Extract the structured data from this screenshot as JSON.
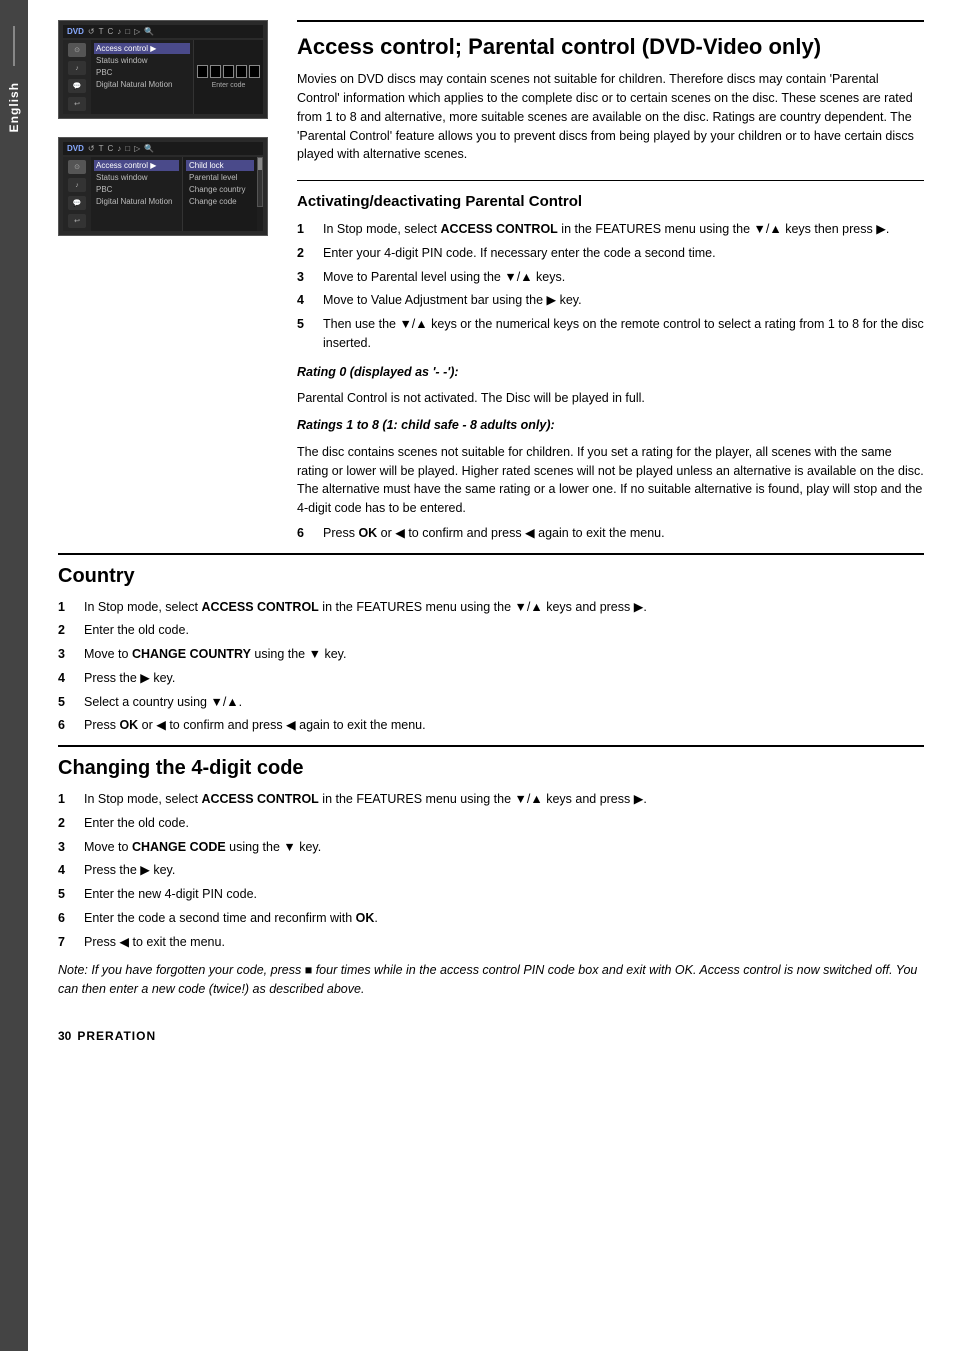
{
  "side_tab": {
    "label": "English"
  },
  "page": {
    "title": "Access control; Parental control (DVD-Video only)",
    "intro": "Movies on DVD discs may contain scenes not suitable for children. Therefore discs may contain 'Parental Control' information which applies to the complete disc or to certain scenes on the disc. These scenes are rated from 1 to 8 and alternative, more suitable scenes are available on the disc. Ratings are country dependent. The 'Parental Control' feature allows you to prevent discs from being played by your children or to have certain discs played with alternative scenes."
  },
  "section1": {
    "heading": "Activating/deactivating Parental Control",
    "steps": [
      {
        "num": "1",
        "text": "In Stop mode, select ACCESS CONTROL in the FEATURES menu using the ▼/▲ keys then press ▶."
      },
      {
        "num": "2",
        "text": "Enter your 4-digit PIN code. If necessary enter the code a second time."
      },
      {
        "num": "3",
        "text": "Move to Parental level using the ▼/▲ keys."
      },
      {
        "num": "4",
        "text": "Move to Value Adjustment bar using the ▶ key."
      },
      {
        "num": "5",
        "text": "Then use the ▼/▲ keys or the numerical keys on the remote control to select a rating from 1 to 8 for the disc inserted."
      }
    ],
    "rating0_label": "Rating 0 (displayed as '- -'):",
    "rating0_text": "Parental Control is not activated. The Disc will be played in full.",
    "ratings18_label": "Ratings 1 to 8 (1: child safe - 8 adults only):",
    "ratings18_text": "The disc contains scenes not suitable for children. If you set a rating for the player, all scenes with the same rating or lower will be played. Higher rated scenes will not be played unless an alternative is available on the disc. The alternative must have the same rating or a lower one. If no suitable alternative is found, play will stop and the 4-digit code has to be entered.",
    "step6": {
      "num": "6",
      "text": "Press OK or ◀ to confirm and press ◀ again to exit the menu."
    }
  },
  "section_country": {
    "heading": "Country",
    "steps": [
      {
        "num": "1",
        "text": "In Stop mode, select ACCESS CONTROL in the FEATURES menu using the ▼/▲ keys and press ▶."
      },
      {
        "num": "2",
        "text": "Enter the old code."
      },
      {
        "num": "3",
        "text": "Move to CHANGE COUNTRY using the ▼ key."
      },
      {
        "num": "4",
        "text": "Press the ▶ key."
      },
      {
        "num": "5",
        "text": "Select a country using ▼/▲."
      },
      {
        "num": "6",
        "text": "Press OK or ◀ to confirm and press ◀ again to exit the menu."
      }
    ]
  },
  "section_code": {
    "heading": "Changing the 4-digit code",
    "steps": [
      {
        "num": "1",
        "text": "In Stop mode, select ACCESS CONTROL in the FEATURES menu using the ▼/▲ keys and press ▶."
      },
      {
        "num": "2",
        "text": "Enter the old code."
      },
      {
        "num": "3",
        "text": "Move to CHANGE CODE using the ▼ key."
      },
      {
        "num": "4",
        "text": "Press the ▶ key."
      },
      {
        "num": "5",
        "text": "Enter the new 4-digit PIN code."
      },
      {
        "num": "6",
        "text": "Enter the code a second time and reconfirm with OK."
      },
      {
        "num": "7",
        "text": "Press ◀ to exit the menu."
      }
    ],
    "note": "Note: If you have forgotten your code, press ■ four times while in the access control PIN code box and exit with OK. Access control is now switched off. You can then enter a new code (twice!) as described above."
  },
  "footer": {
    "page_num": "30",
    "label": "PRERATION"
  },
  "dvd_menu1": {
    "items": [
      "Access control",
      "Status window",
      "PBC",
      "Digital Natural Motion"
    ],
    "selected": "Access control",
    "code_label": "Enter code"
  },
  "dvd_menu2": {
    "items": [
      "Access control",
      "Status window",
      "PBC",
      "Digital Natural Motion"
    ],
    "selected": "Access control",
    "submenu_items": [
      "Child lock",
      "Parental level",
      "Change country",
      "Change code"
    ],
    "submenu_selected": "Child lock"
  }
}
